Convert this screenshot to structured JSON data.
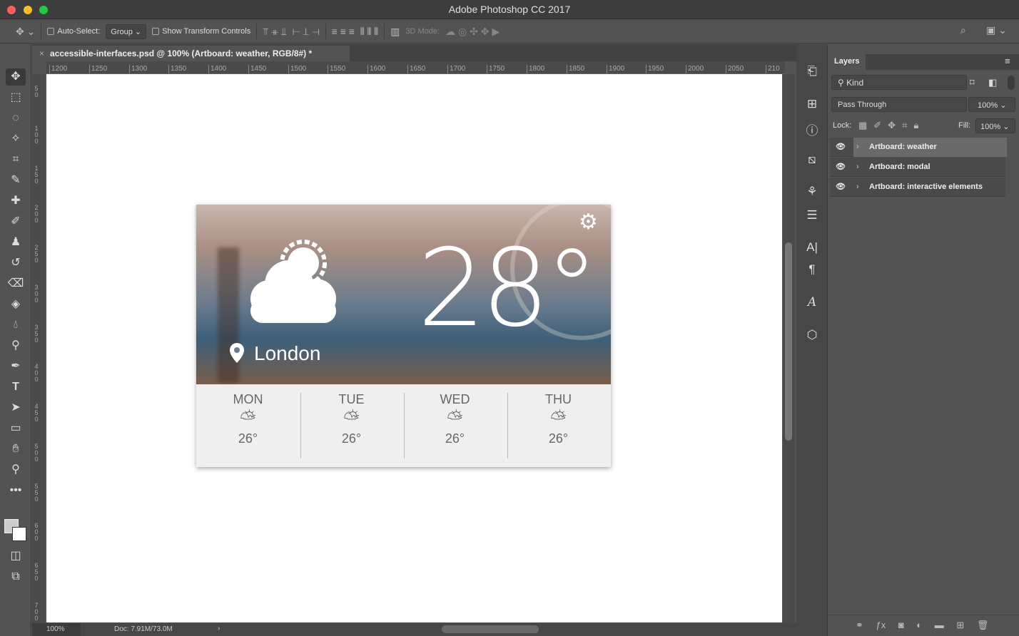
{
  "window": {
    "title": "Adobe Photoshop CC 2017"
  },
  "options": {
    "auto_select_label": "Auto-Select:",
    "auto_select_value": "Group",
    "show_transform_label": "Show Transform Controls",
    "mode_3d_label": "3D Mode:"
  },
  "document": {
    "tab_title": "accessible-interfaces.psd @ 100% (Artboard: weather, RGB/8#) *",
    "zoom": "100%",
    "doc_size": "Doc: 7.91M/73.0M"
  },
  "rulers": {
    "horizontal": [
      "1200",
      "1250",
      "1300",
      "1350",
      "1400",
      "1450",
      "1500",
      "1550",
      "1600",
      "1650",
      "1700",
      "1750",
      "1800",
      "1850",
      "1900",
      "1950",
      "2000",
      "2050",
      "210"
    ],
    "vertical": [
      "50",
      "100",
      "150",
      "200",
      "250",
      "300",
      "350",
      "400",
      "450",
      "500",
      "550",
      "600",
      "650",
      "700",
      "750"
    ]
  },
  "weather": {
    "temperature": "28°",
    "city": "London",
    "forecast": [
      {
        "day": "MON",
        "temp": "26°"
      },
      {
        "day": "TUE",
        "temp": "26°"
      },
      {
        "day": "WED",
        "temp": "26°"
      },
      {
        "day": "THU",
        "temp": "26°"
      }
    ]
  },
  "layers_panel": {
    "title": "Layers",
    "filter_placeholder": "Kind",
    "blend_mode": "Pass Through",
    "opacity": "100%",
    "lock_label": "Lock:",
    "fill_label": "Fill:",
    "fill": "100%",
    "layers": [
      {
        "name": "Artboard: weather",
        "selected": true
      },
      {
        "name": "Artboard: modal",
        "selected": false
      },
      {
        "name": "Artboard: interactive elements",
        "selected": false
      }
    ]
  }
}
